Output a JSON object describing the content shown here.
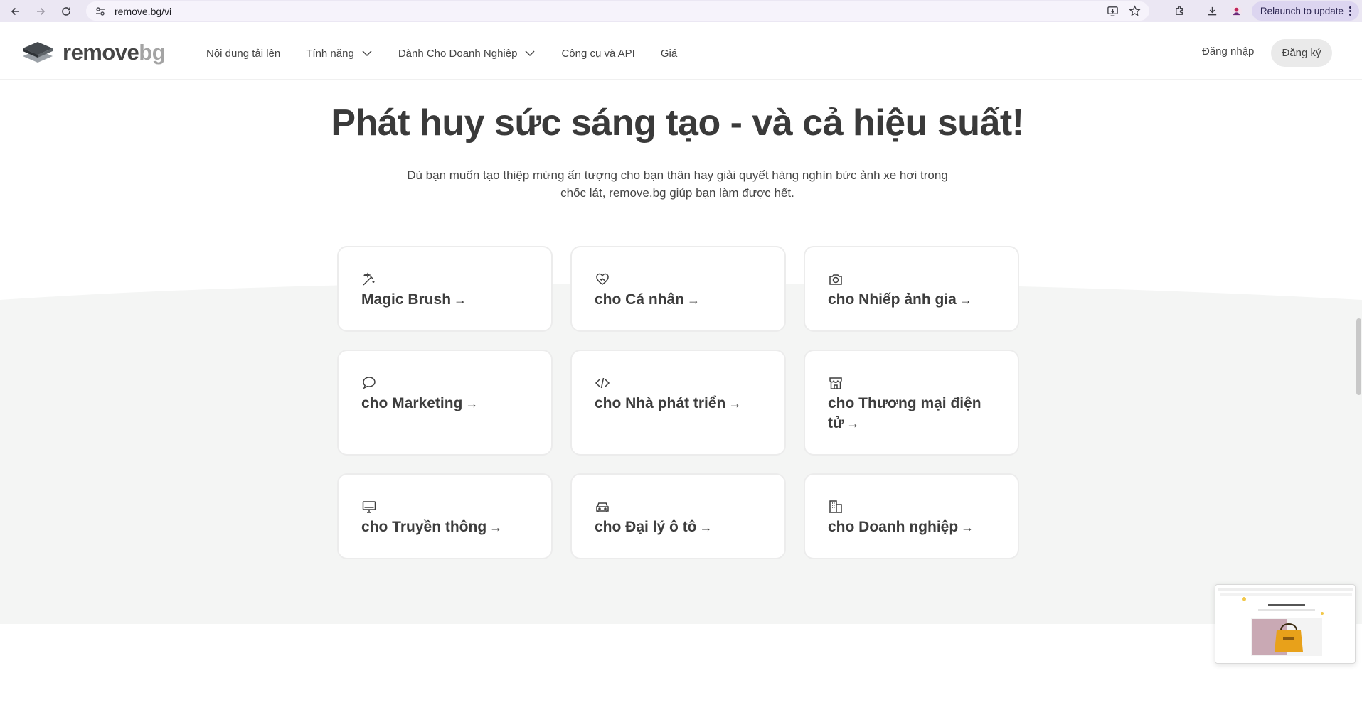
{
  "browser": {
    "url": "remove.bg/vi",
    "relaunch_label": "Relaunch to update"
  },
  "header": {
    "logo_main": "remove",
    "logo_accent": "bg",
    "nav": [
      {
        "label": "Nội dung tải lên",
        "dropdown": false
      },
      {
        "label": "Tính năng",
        "dropdown": true
      },
      {
        "label": "Dành Cho Doanh Nghiệp",
        "dropdown": true
      },
      {
        "label": "Công cụ và API",
        "dropdown": false
      },
      {
        "label": "Giá",
        "dropdown": false
      }
    ],
    "login_label": "Đăng nhập",
    "signup_label": "Đăng ký"
  },
  "hero": {
    "title": "Phát huy sức sáng tạo - và cả hiệu suất!",
    "subtitle": "Dù bạn muốn tạo thiệp mừng ấn tượng cho bạn thân hay giải quyết hàng nghìn bức ảnh xe hơi trong chốc lát, remove.bg giúp bạn làm được hết."
  },
  "cards": [
    {
      "label": "Magic Brush",
      "icon": "magic-wand-icon"
    },
    {
      "label": "cho Cá nhân",
      "icon": "heart-handshake-icon"
    },
    {
      "label": "cho Nhiếp ảnh gia",
      "icon": "camera-icon"
    },
    {
      "label": "cho Marketing",
      "icon": "speech-bubble-icon"
    },
    {
      "label": "cho Nhà phát triển",
      "icon": "code-icon"
    },
    {
      "label": "cho Thương mại điện tử",
      "icon": "storefront-icon"
    },
    {
      "label": "cho Truyền thông",
      "icon": "monitor-icon"
    },
    {
      "label": "cho Đại lý ô tô",
      "icon": "car-icon"
    },
    {
      "label": "cho Doanh nghiệp",
      "icon": "building-icon"
    }
  ],
  "colors": {
    "text": "#454545",
    "section_bg": "#f4f5f4",
    "card_border": "#ececec",
    "chrome_bg": "#ebe7f3"
  }
}
